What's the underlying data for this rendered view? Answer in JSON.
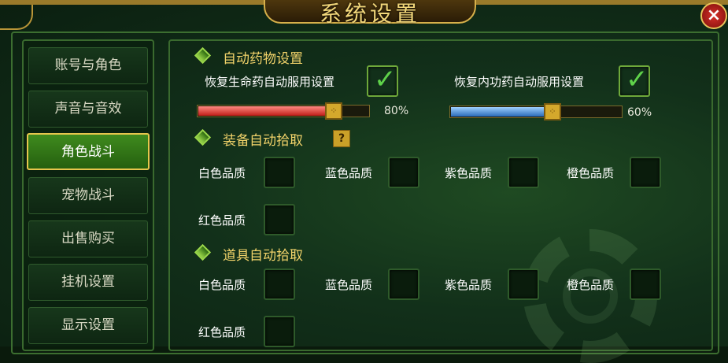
{
  "window": {
    "title": "系统设置",
    "close_icon": "×"
  },
  "sidebar": {
    "items": [
      {
        "label": "账号与角色"
      },
      {
        "label": "声音与音效"
      },
      {
        "label": "角色战斗",
        "active": true
      },
      {
        "label": "宠物战斗"
      },
      {
        "label": "出售购买"
      },
      {
        "label": "挂机设置"
      },
      {
        "label": "显示设置"
      }
    ]
  },
  "auto_medicine": {
    "title": "自动药物设置",
    "hp": {
      "label": "恢复生命药自动服用设置",
      "checked": true,
      "percent": 80,
      "percent_text": "80%"
    },
    "mp": {
      "label": "恢复内功药自动服用设置",
      "checked": true,
      "percent": 60,
      "percent_text": "60%"
    }
  },
  "equip_pickup": {
    "title": "装备自动拾取",
    "help": "?",
    "options": [
      {
        "label": "白色品质",
        "checked": false
      },
      {
        "label": "蓝色品质",
        "checked": false
      },
      {
        "label": "紫色品质",
        "checked": false
      },
      {
        "label": "橙色品质",
        "checked": false
      },
      {
        "label": "红色品质",
        "checked": false
      }
    ]
  },
  "item_pickup": {
    "title": "道具自动拾取",
    "options": [
      {
        "label": "白色品质",
        "checked": false
      },
      {
        "label": "蓝色品质",
        "checked": false
      },
      {
        "label": "紫色品质",
        "checked": false
      },
      {
        "label": "橙色品质",
        "checked": false
      },
      {
        "label": "红色品质",
        "checked": false
      }
    ]
  },
  "colors": {
    "accent_gold": "#e6c64c",
    "hp_bar": "#c01e18",
    "mp_bar": "#2a6ab8",
    "check": "#5fd24a"
  }
}
